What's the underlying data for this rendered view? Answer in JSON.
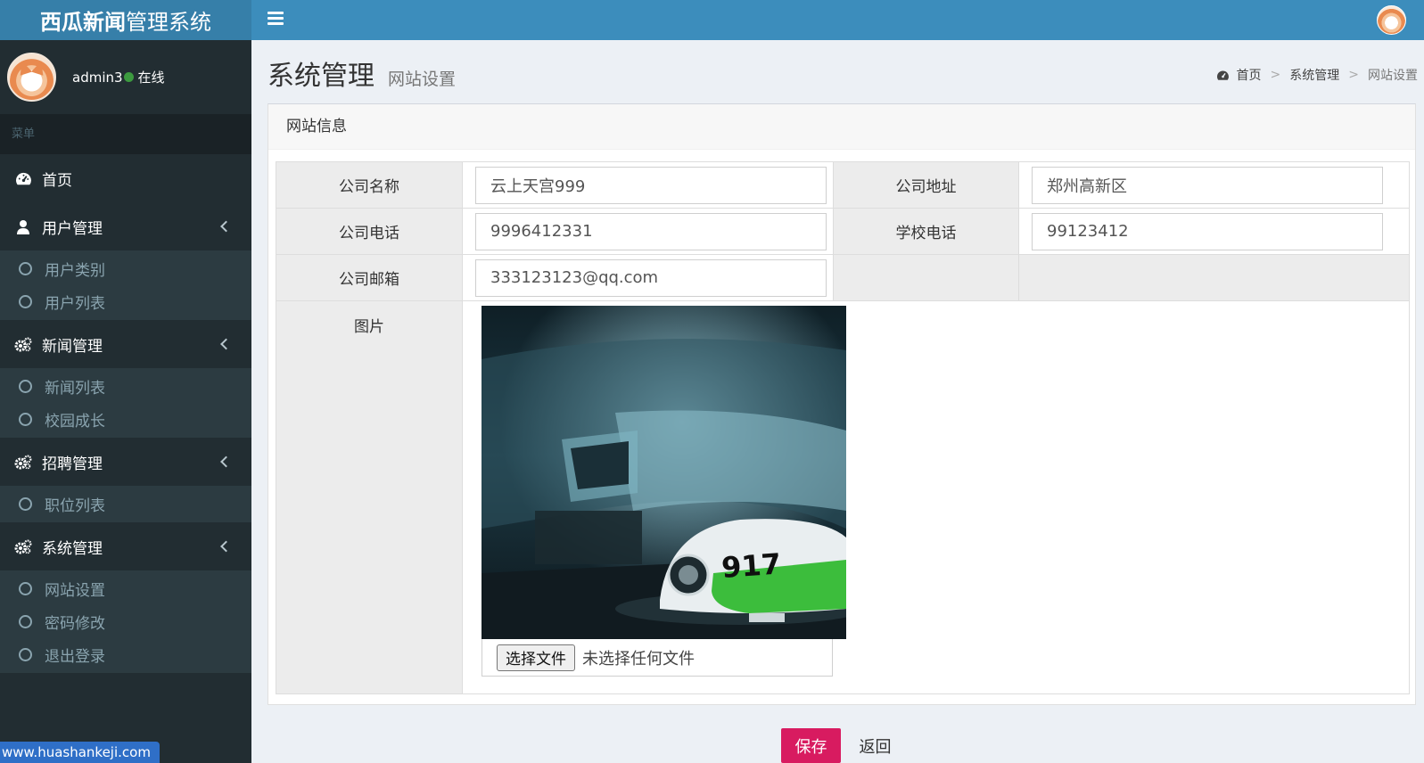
{
  "app": {
    "logo_bold": "西瓜新闻",
    "logo_rest": "管理系统"
  },
  "user": {
    "name": "admin3",
    "status": "在线",
    "status_color": "#3c9a3f"
  },
  "sidebar": {
    "menu_header": "菜单",
    "home": "首页",
    "groups": [
      {
        "label": "用户管理",
        "icon": "user-icon",
        "items": [
          "用户类别",
          "用户列表"
        ]
      },
      {
        "label": "新闻管理",
        "icon": "gears-icon",
        "items": [
          "新闻列表",
          "校园成长"
        ]
      },
      {
        "label": "招聘管理",
        "icon": "gears-icon",
        "items": [
          "职位列表"
        ]
      },
      {
        "label": "系统管理",
        "icon": "gears-icon",
        "items": [
          "网站设置",
          "密码修改",
          "退出登录"
        ]
      }
    ]
  },
  "watermark": "www.huashankeji.com",
  "page": {
    "title": "系统管理",
    "subtitle": "网站设置"
  },
  "breadcrumb": {
    "home": "首页",
    "section": "系统管理",
    "current": "网站设置",
    "sep": ">"
  },
  "box": {
    "title": "网站信息"
  },
  "form": {
    "company_name_label": "公司名称",
    "company_name_value": "云上天宫999",
    "company_address_label": "公司地址",
    "company_address_value": "郑州高新区",
    "company_phone_label": "公司电话",
    "company_phone_value": "9996412331",
    "school_phone_label": "学校电话",
    "school_phone_value": "99123412",
    "company_email_label": "公司邮箱",
    "company_email_value": "333123123@qq.com",
    "image_label": "图片",
    "file_button": "选择文件",
    "file_status": "未选择任何文件"
  },
  "actions": {
    "save": "保存",
    "back": "返回"
  },
  "colors": {
    "topbar": "#3c8dbc",
    "sidebar": "#222d32",
    "save": "#d81b60"
  }
}
